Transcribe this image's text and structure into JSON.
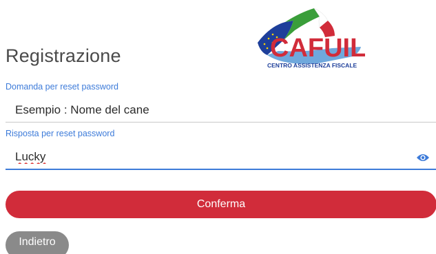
{
  "header": {
    "title": "Registrazione"
  },
  "logo": {
    "brand": "CAFUIL",
    "tagline": "CENTRO ASSISTENZA FISCALE"
  },
  "form": {
    "question": {
      "label": "Domanda per reset password",
      "value": "Esempio : Nome del cane"
    },
    "answer": {
      "label": "Risposta per reset password",
      "value": "Lucky",
      "toggle_icon": "eye-icon"
    }
  },
  "buttons": {
    "confirm_label": "Conferma",
    "back_label": "Indietro"
  },
  "colors": {
    "accent": "#3d7bd9",
    "confirm": "#d12c3a",
    "back": "#8a8a8a"
  }
}
